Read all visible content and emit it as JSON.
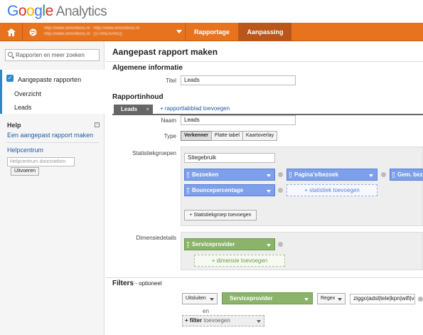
{
  "app": {
    "logo_google": "Google",
    "logo_product": "Analytics"
  },
  "nav": {
    "account_line1": "http://www.simonboss.nl · http://www.simonboss.nl",
    "account_line2": "http://www.simonboss.nl · [STANDAARD]",
    "tabs": [
      {
        "label": "Rapportage"
      },
      {
        "label": "Aanpassing"
      }
    ]
  },
  "sidebar": {
    "search_placeholder": "Rapporten en meer zoeken",
    "section_title": "Aangepaste rapporten",
    "items": [
      {
        "label": "Overzicht"
      },
      {
        "label": "Leads"
      }
    ],
    "help_title": "Help",
    "help_link": "Een aangepast rapport maken",
    "help_center": "Helpcentrum",
    "help_search_placeholder": "Helpcentrum doorzoeken",
    "help_search_button": "Uitvoeren"
  },
  "main": {
    "title": "Aangepast rapport maken",
    "general_heading": "Algemene informatie",
    "title_label": "Titel",
    "title_value": "Leads",
    "content_heading": "Rapportinhoud",
    "report_tab": "Leads",
    "report_tab_close": "×",
    "add_tab": "+ rapporttabblad toevoegen",
    "name_label": "Naam",
    "name_value": "Leads",
    "type_label": "Type",
    "types": [
      "Verkenner",
      "Platte tabel",
      "Kaartoverlay"
    ],
    "metric_groups_label": "Statistiekgroepen",
    "metric_group_name": "Sitegebruik",
    "metrics": [
      "Bezoeken",
      "Pagina's/bezoek",
      "Gem. bez",
      "Bouncepercentage"
    ],
    "add_metric": "+ statistiek toevoegen",
    "add_metric_group": "+ Statistiekgroep toevoegen",
    "dimension_label": "Dimensiedetails",
    "dimension": "Serviceprovider",
    "add_dimension": "+ dimensie toevoegen",
    "filters_heading": "Filters",
    "filters_optional": " - optioneel",
    "filter_mode": "Uitsluiten",
    "filter_dimension": "Serviceprovider",
    "filter_match": "Regex",
    "filter_value": "ziggo|adsl|tele|kpn|wifi|vo",
    "filter_and": "en",
    "add_filter_prefix": "+ filter",
    "add_filter_suffix": " toevoegen"
  }
}
